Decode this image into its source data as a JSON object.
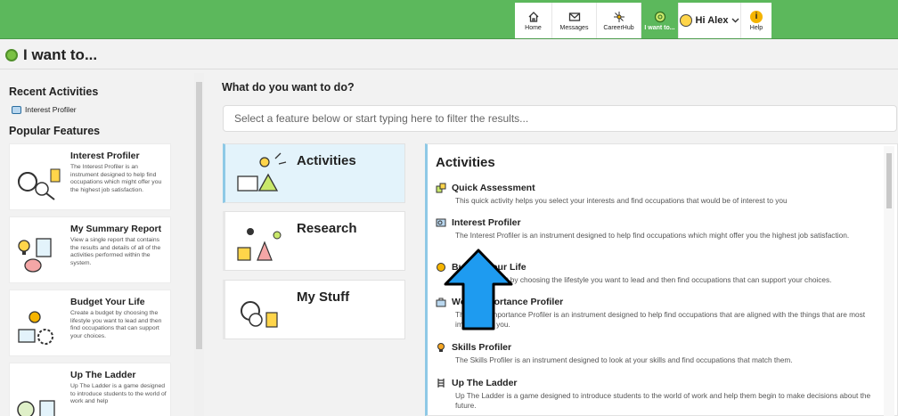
{
  "nav": {
    "home": "Home",
    "messages": "Messages",
    "careerhub": "CareerHub",
    "iwantto": "I want to...",
    "user": "Hi Alex",
    "help": "Help"
  },
  "page": {
    "title": "I want to..."
  },
  "sidebar": {
    "recent_heading": "Recent Activities",
    "recent_items": [
      "Interest Profiler"
    ],
    "popular_heading": "Popular Features",
    "features": [
      {
        "title": "Interest Profiler",
        "desc": "The Interest Profiler is an instrument designed to help find occupations which might offer you the highest job satisfaction."
      },
      {
        "title": "My Summary Report",
        "desc": "View a single report that contains the results and details of all of the activities performed within the system."
      },
      {
        "title": "Budget Your Life",
        "desc": "Create a budget by choosing the lifestyle you want to lead and then find occupations that can support your choices."
      },
      {
        "title": "Up The Ladder",
        "desc": "Up The Ladder is a game designed to introduce students to the world of work and help"
      }
    ]
  },
  "main": {
    "question": "What do you want to do?",
    "filter_placeholder": "Select a feature below or start typing here to filter the results...",
    "categories": [
      "Activities",
      "Research",
      "My Stuff"
    ],
    "panel_title": "Activities",
    "activities": [
      {
        "name": "Quick Assessment",
        "desc": "This quick activity helps you select your interests and find occupations that would be of interest to you"
      },
      {
        "name": "Interest Profiler",
        "desc": "The Interest Profiler is an instrument designed to help find occupations which might offer you the highest job satisfaction."
      },
      {
        "name": "Budget Your Life",
        "desc": "Create a budget by choosing the lifestyle you want to lead and then find occupations that can support your choices."
      },
      {
        "name": "Work Importance Profiler",
        "desc": "The Work Importance Profiler is an instrument designed to help find occupations that are aligned with the things that are most important to you."
      },
      {
        "name": "Skills Profiler",
        "desc": "The Skills Profiler is an instrument designed to look at your skills and find occupations that match them."
      },
      {
        "name": "Up The Ladder",
        "desc": "Up The Ladder is a game designed to introduce students to the world of work and help them begin to make decisions about the future."
      }
    ]
  },
  "colors": {
    "brand_green": "#5cb85c",
    "active_blue": "#e3f3fb",
    "arrow_blue": "#1e9bf0"
  }
}
